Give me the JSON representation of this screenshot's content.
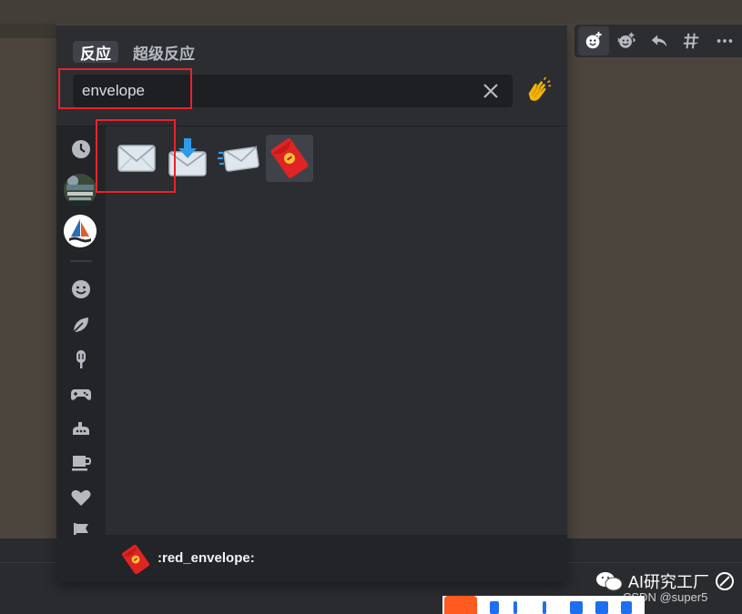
{
  "picker": {
    "tabs": [
      {
        "label": "反应",
        "active": true
      },
      {
        "label": "超级反应",
        "active": false
      }
    ],
    "search": {
      "value": "envelope",
      "placeholder": ""
    },
    "rail": {
      "categories": [
        "recent-clock-icon",
        "people-smiley-icon",
        "nature-leaf-icon",
        "food-popsicle-icon",
        "activity-gamepad-icon",
        "travel-submarine-icon",
        "objects-cup-icon",
        "symbols-heart-icon",
        "flags-flag-icon"
      ],
      "servers": [
        "server-avatar-1",
        "server-avatar-2"
      ]
    },
    "results": [
      {
        "name": "envelope",
        "icon": "envelope-icon"
      },
      {
        "name": "envelope_with_arrow",
        "icon": "envelope-with-arrow-icon"
      },
      {
        "name": "incoming_envelope",
        "icon": "incoming-envelope-icon"
      },
      {
        "name": "red_envelope",
        "icon": "red-envelope-icon",
        "selected": true
      }
    ],
    "preview": {
      "label": ":red_envelope:"
    }
  },
  "actionbar": {
    "items": [
      "add-reaction-icon",
      "add-super-reaction-icon",
      "reply-icon",
      "create-thread-icon",
      "more-icon"
    ]
  },
  "watermark": {
    "title": "AI研究工厂",
    "sub": "CSDN @super5"
  },
  "colors": {
    "accent_red": "#e8232a",
    "panel": "#2b2d31",
    "rail": "#232428"
  }
}
